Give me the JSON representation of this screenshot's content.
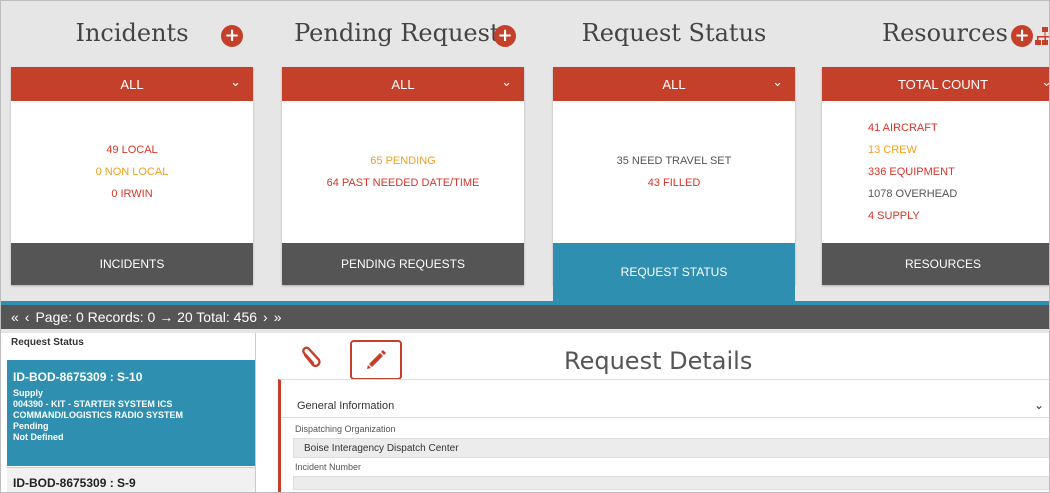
{
  "dashboard": {
    "incidents": {
      "title": "Incidents",
      "filter": "ALL",
      "lines": [
        "49 LOCAL",
        "0 NON LOCAL",
        "0 IRWIN"
      ],
      "footer": "INCIDENTS"
    },
    "pending": {
      "title": "Pending Requests",
      "filter": "ALL",
      "lines": [
        "65 PENDING",
        "64 PAST NEEDED DATE/TIME"
      ],
      "footer": "PENDING REQUESTS"
    },
    "status": {
      "title": "Request Status",
      "filter": "ALL",
      "lines": [
        "35 NEED TRAVEL SET",
        "43 FILLED"
      ],
      "footer": "REQUEST STATUS"
    },
    "resources": {
      "title": "Resources",
      "filter": "TOTAL COUNT",
      "lines": [
        "41 AIRCRAFT",
        "13 CREW",
        "336 EQUIPMENT",
        "1078 OVERHEAD",
        "4 SUPPLY"
      ],
      "footer": "RESOURCES"
    }
  },
  "pager": {
    "first": "«",
    "prev": "‹",
    "text": "Page: 0 Records: 0 → 20 Total: 456",
    "next": "›",
    "last": "»"
  },
  "request_list": {
    "title": "Request Status",
    "selected": {
      "id": "ID-BOD-8675309 : S-10",
      "category": "Supply",
      "desc1": "004390 - KIT - STARTER SYSTEM ICS",
      "desc2": "COMMAND/LOGISTICS RADIO SYSTEM",
      "status": "Pending",
      "extra": "Not Defined"
    },
    "next": {
      "id": "ID-BOD-8675309 : S-9"
    }
  },
  "details": {
    "title": "Request Details",
    "section": "General Information",
    "dispatch_label": "Dispatching Organization",
    "dispatch_value": "Boise Interagency Dispatch Center",
    "incident_label": "Incident Number"
  },
  "colors": {
    "accent": "#c4402a",
    "active": "#2e8fb0",
    "red_text": "#d6352a",
    "orange_text": "#f0a020"
  }
}
